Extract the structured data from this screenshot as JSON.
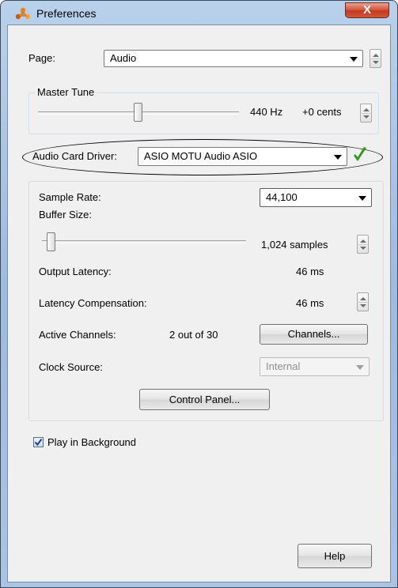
{
  "window": {
    "title": "Preferences",
    "close_label": "X"
  },
  "page": {
    "label": "Page:",
    "value": "Audio"
  },
  "master_tune": {
    "group_label": "Master Tune",
    "hz": "440 Hz",
    "cents": "+0 cents"
  },
  "driver": {
    "label": "Audio Card Driver:",
    "value": "ASIO MOTU Audio ASIO",
    "status_color": "#2f9a1c"
  },
  "audio": {
    "sample_rate_label": "Sample Rate:",
    "sample_rate_value": "44,100",
    "buffer_size_label": "Buffer Size:",
    "buffer_value": "1,024 samples",
    "output_latency_label": "Output Latency:",
    "output_latency_value": "46 ms",
    "latency_comp_label": "Latency Compensation:",
    "latency_comp_value": "46 ms",
    "active_channels_label": "Active Channels:",
    "active_channels_value": "2 out of 30",
    "channels_button": "Channels...",
    "clock_source_label": "Clock Source:",
    "clock_source_value": "Internal",
    "control_panel_button": "Control Panel..."
  },
  "play_in_background": {
    "label": "Play in Background",
    "checked": true
  },
  "help_button": "Help"
}
